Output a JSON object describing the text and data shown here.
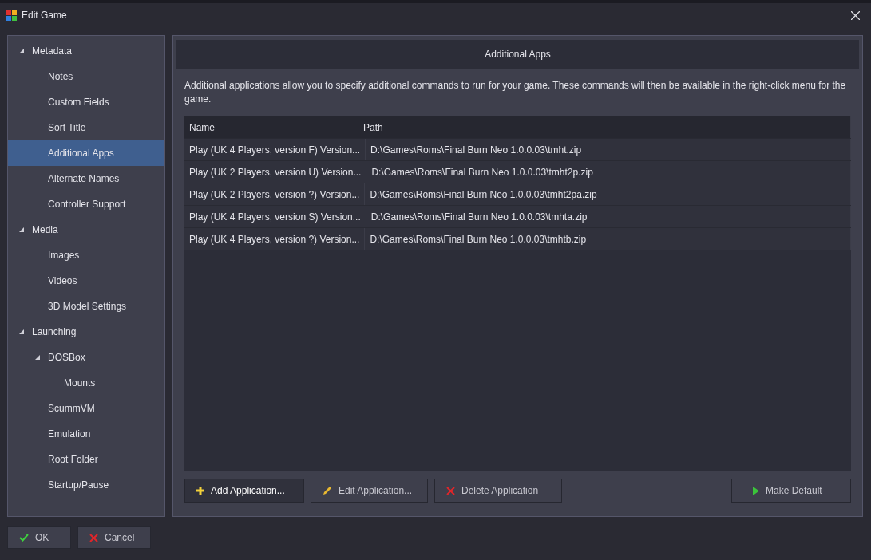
{
  "window": {
    "title": "Edit Game"
  },
  "sidebar": {
    "items": [
      {
        "label": "Metadata",
        "expanded": true,
        "selected": false,
        "children": [
          {
            "label": "Notes",
            "selected": false
          },
          {
            "label": "Custom Fields",
            "selected": false
          },
          {
            "label": "Sort Title",
            "selected": false
          },
          {
            "label": "Additional Apps",
            "selected": true
          },
          {
            "label": "Alternate Names",
            "selected": false
          },
          {
            "label": "Controller Support",
            "selected": false
          }
        ]
      },
      {
        "label": "Media",
        "expanded": true,
        "selected": false,
        "children": [
          {
            "label": "Images",
            "selected": false
          },
          {
            "label": "Videos",
            "selected": false
          },
          {
            "label": "3D Model Settings",
            "selected": false
          }
        ]
      },
      {
        "label": "Launching",
        "expanded": true,
        "selected": false,
        "children": [
          {
            "label": "DOSBox",
            "expanded": true,
            "selected": false,
            "children": [
              {
                "label": "Mounts",
                "selected": false
              }
            ]
          },
          {
            "label": "ScummVM",
            "selected": false
          },
          {
            "label": "Emulation",
            "selected": false
          },
          {
            "label": "Root Folder",
            "selected": false
          },
          {
            "label": "Startup/Pause",
            "selected": false
          }
        ]
      }
    ]
  },
  "panel": {
    "title": "Additional Apps",
    "description": "Additional applications allow you to specify additional commands to run for your game.  These commands will then be available in the right-click menu for the game."
  },
  "table": {
    "columns": [
      "Name",
      "Path"
    ],
    "rows": [
      [
        "Play (UK 4 Players, version F) Version...",
        "D:\\Games\\Roms\\Final Burn Neo 1.0.0.03\\tmht.zip"
      ],
      [
        "Play (UK 2 Players, version U) Version...",
        "D:\\Games\\Roms\\Final Burn Neo 1.0.0.03\\tmht2p.zip"
      ],
      [
        "Play (UK 2 Players, version ?) Version...",
        "D:\\Games\\Roms\\Final Burn Neo 1.0.0.03\\tmht2pa.zip"
      ],
      [
        "Play (UK 4 Players, version S) Version...",
        "D:\\Games\\Roms\\Final Burn Neo 1.0.0.03\\tmhta.zip"
      ],
      [
        "Play (UK 4 Players, version ?) Version...",
        "D:\\Games\\Roms\\Final Burn Neo 1.0.0.03\\tmhtb.zip"
      ]
    ]
  },
  "actions": [
    {
      "kind": "add",
      "label": "Add Application...",
      "focused": true
    },
    {
      "kind": "edit",
      "label": "Edit Application...",
      "focused": false
    },
    {
      "kind": "delete",
      "label": "Delete Application",
      "focused": false
    },
    {
      "kind": "default",
      "label": "Make Default",
      "focused": false
    }
  ],
  "buttons": [
    {
      "kind": "ok",
      "label": "OK"
    },
    {
      "kind": "cancel",
      "label": "Cancel"
    }
  ]
}
